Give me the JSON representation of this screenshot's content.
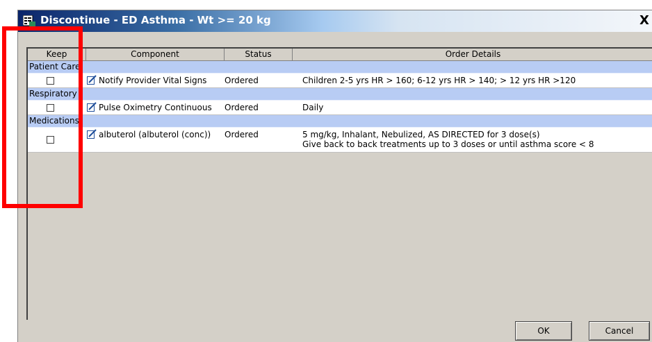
{
  "dialog": {
    "title": "Discontinue - ED Asthma - Wt >= 20 kg",
    "close_label": "X"
  },
  "table": {
    "columns": [
      "Keep",
      "Component",
      "Status",
      "Order Details"
    ],
    "groups": [
      {
        "label": "Patient Care",
        "rows": [
          {
            "component": "Notify Provider Vital Signs",
            "status": "Ordered",
            "details": [
              "Children 2-5 yrs HR > 160; 6-12 yrs HR > 140; > 12 yrs HR >120"
            ]
          }
        ]
      },
      {
        "label": "Respiratory",
        "rows": [
          {
            "component": "Pulse Oximetry Continuous",
            "status": "Ordered",
            "details": [
              "Daily"
            ]
          }
        ]
      },
      {
        "label": "Medications",
        "rows": [
          {
            "component": "albuterol (albuterol (conc))",
            "status": "Ordered",
            "details": [
              "5 mg/kg, Inhalant, Nebulized, AS DIRECTED for 3 dose(s)",
              "Give back to back treatments up to 3 doses or until asthma score < 8"
            ]
          }
        ]
      }
    ]
  },
  "buttons": {
    "ok": "OK",
    "cancel": "Cancel"
  },
  "colors": {
    "highlight_box": "#ff0000",
    "group_row": "#b8ccf4",
    "title_bar": "#0a246a"
  }
}
